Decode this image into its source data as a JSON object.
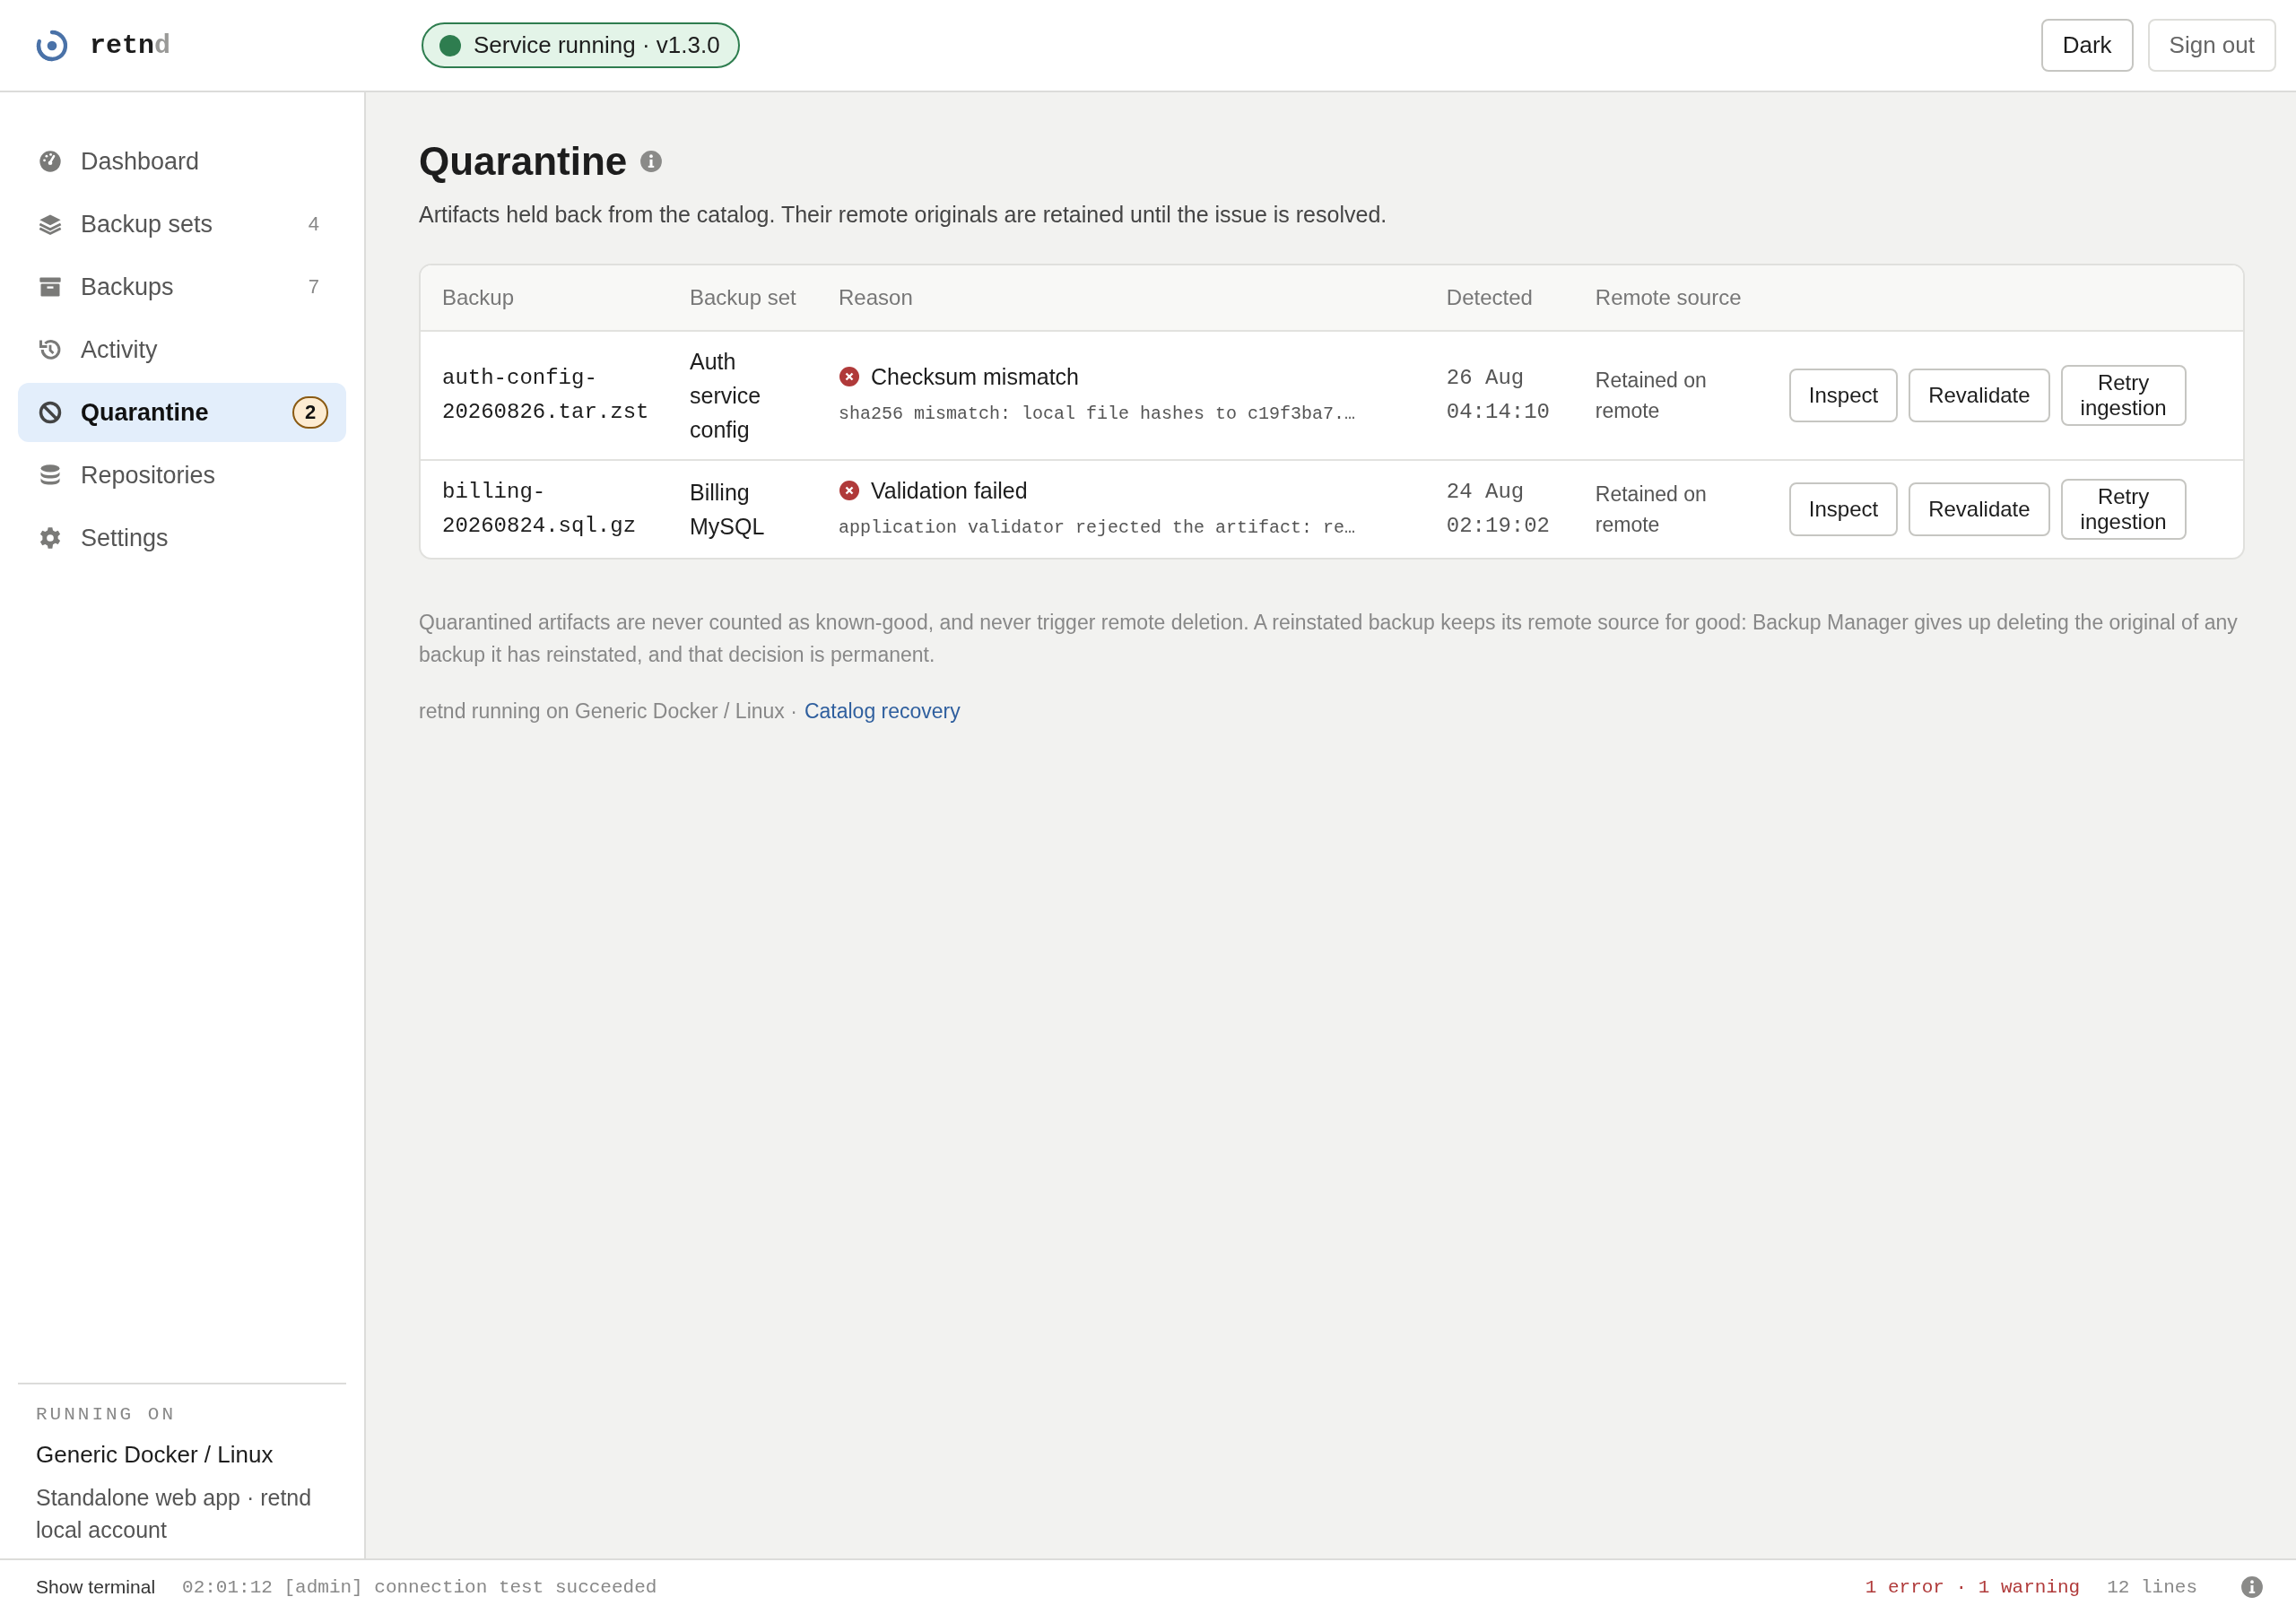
{
  "header": {
    "brand": "retn",
    "brand_dim": "d",
    "service": {
      "label": "Service running · v1.3.0",
      "running": true
    },
    "buttons": [
      {
        "label": "Dark",
        "kind": "primary"
      },
      {
        "label": "Sign out",
        "kind": "secondary"
      }
    ]
  },
  "sidebar": {
    "items": [
      {
        "label": "Dashboard",
        "selected": false
      },
      {
        "label": "Backup sets",
        "count": "4",
        "alert": false,
        "selected": false
      },
      {
        "label": "Backups",
        "count": "7",
        "alert": false,
        "selected": false
      },
      {
        "label": "Activity",
        "selected": false
      },
      {
        "label": "Quarantine",
        "count": "2",
        "alert": true,
        "selected": true
      },
      {
        "label": "Repositories",
        "selected": false
      },
      {
        "label": "Settings",
        "selected": false
      }
    ],
    "footer": {
      "heading": "RUNNING ON",
      "platform": "Generic Docker / Linux",
      "description": "Standalone web app · retnd local account"
    }
  },
  "page": {
    "title": "Quarantine",
    "subtitle": "Artifacts held back from the catalog. Their remote originals are retained until the issue is resolved.",
    "table": {
      "columns": [
        "Backup",
        "Backup set",
        "Reason",
        "Detected",
        "Remote source"
      ],
      "rows": [
        {
          "backup": "auth-config-20260826.tar.zst",
          "backup_set": "Auth service config",
          "reason": {
            "title": "Checksum mismatch",
            "detail": "sha256 mismatch: local file hashes to c19f3ba7.…",
            "failed": true
          },
          "detected": "26 Aug 04:14:10",
          "remote_source": "Retained on remote",
          "actions": [
            "Inspect",
            "Revalidate",
            "Retry ingestion"
          ]
        },
        {
          "backup": "billing-20260824.sql.gz",
          "backup_set": "Billing MySQL",
          "reason": {
            "title": "Validation failed",
            "detail": "application validator rejected the artifact: re…",
            "failed": true
          },
          "detected": "24 Aug 02:19:02",
          "remote_source": "Retained on remote",
          "actions": [
            "Inspect",
            "Revalidate",
            "Retry ingestion"
          ]
        }
      ]
    },
    "note": "Quarantined artifacts are never counted as known-good, and never trigger remote deletion. A reinstated backup keeps its remote source for good: Backup Manager gives up deleting the original of any backup it has reinstated, and that decision is permanent.",
    "footer": {
      "text": "retnd running on Generic Docker / Linux ·",
      "link": "Catalog recovery"
    }
  },
  "status_bar": {
    "toggle": "Show terminal",
    "last_line": "02:01:12 [admin] connection test succeeded",
    "problems": "1 error · 1 warning",
    "lines": "12 lines"
  }
}
